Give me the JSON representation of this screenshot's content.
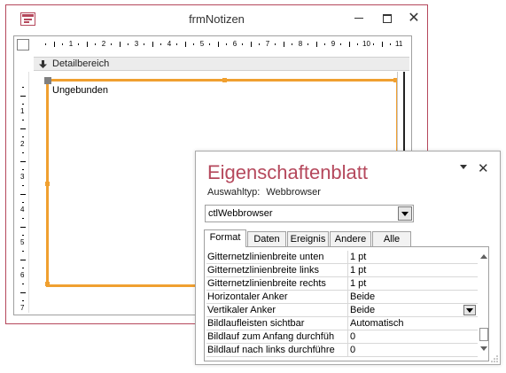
{
  "form_window": {
    "title": "frmNotizen",
    "buttons": {
      "minimize": "minimize-icon",
      "maximize": "maximize-icon",
      "close": "✕"
    },
    "ruler_numbers": [
      "1",
      "2",
      "3",
      "4",
      "5",
      "6",
      "7",
      "8",
      "9",
      "10",
      "11"
    ],
    "vruler_numbers": [
      "1",
      "2",
      "3",
      "4",
      "5",
      "6",
      "7"
    ],
    "section_label": "Detailbereich",
    "control_label": "Ungebunden",
    "accent_color": "#f0a030",
    "brand_color": "#b5485c"
  },
  "property_sheet": {
    "title": "Eigenschaftenblatt",
    "close_label": "✕",
    "selection_type_label": "Auswahltyp:",
    "selection_type_value": "Webbrowser",
    "combo_value": "ctlWebbrowser",
    "tabs": [
      "Format",
      "Daten",
      "Ereignis",
      "Andere",
      "Alle"
    ],
    "active_tab": "Format",
    "rows": [
      {
        "name": "Gitternetzlinienbreite unten",
        "value": "1 pt"
      },
      {
        "name": "Gitternetzlinienbreite links",
        "value": "1 pt"
      },
      {
        "name": "Gitternetzlinienbreite rechts",
        "value": "1 pt"
      },
      {
        "name": "Horizontaler Anker",
        "value": "Beide"
      },
      {
        "name": "Vertikaler Anker",
        "value": "Beide"
      },
      {
        "name": "Bildlaufleisten sichtbar",
        "value": "Automatisch"
      },
      {
        "name": "Bildlauf zum Anfang durchfüh",
        "value": "0"
      },
      {
        "name": "Bildlauf nach links durchführe",
        "value": "0"
      }
    ]
  }
}
